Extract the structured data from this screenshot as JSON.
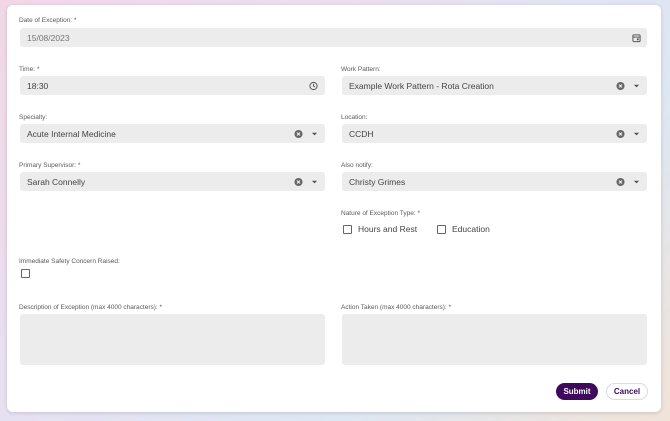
{
  "form": {
    "date": {
      "label": "Date of Exception: *",
      "value": "15/08/2023",
      "icon": "calendar-icon"
    },
    "time": {
      "label": "Time: *",
      "value": "18:30",
      "icon": "clock-icon"
    },
    "work_pattern": {
      "label": "Work Pattern:",
      "value": "Example Work Pattern - Rota Creation"
    },
    "specialty": {
      "label": "Specialty:",
      "value": "Acute Internal Medicine"
    },
    "location": {
      "label": "Location:",
      "value": "CCDH"
    },
    "primary_supervisor": {
      "label": "Primary Supervisor: *",
      "value": "Sarah Connelly"
    },
    "also_notify": {
      "label": "Also notify:",
      "value": "Christy Grimes"
    },
    "nature": {
      "label": "Nature of Exception Type: *",
      "options": [
        {
          "label": "Hours and Rest",
          "checked": false
        },
        {
          "label": "Education",
          "checked": false
        }
      ]
    },
    "safety": {
      "label": "Immediate Safety Concern Raised:",
      "checked": false
    },
    "description": {
      "label": "Description of Exception (max 4000 characters): *",
      "value": ""
    },
    "action": {
      "label": "Action Taken (max 4000 characters): *",
      "value": ""
    }
  },
  "buttons": {
    "submit": "Submit",
    "cancel": "Cancel"
  },
  "colors": {
    "submit_bg": "#3d0a5c",
    "field_bg": "#ececec",
    "card_bg": "#ffffff"
  }
}
